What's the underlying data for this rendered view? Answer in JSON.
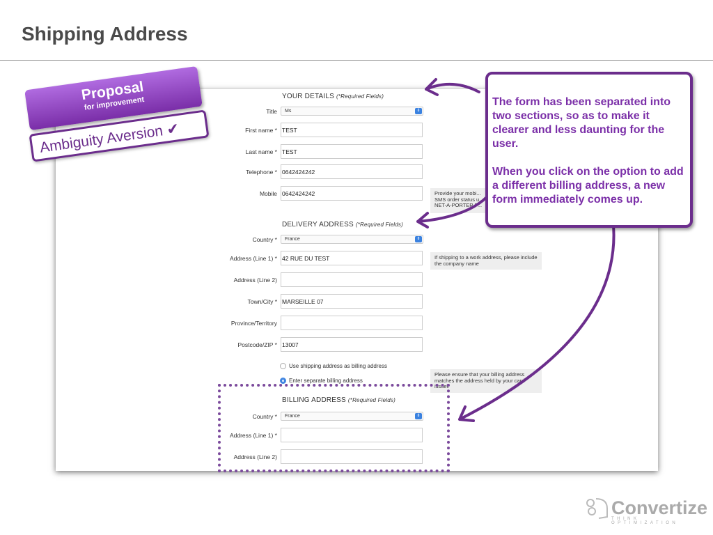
{
  "slide": {
    "title": "Shipping Address"
  },
  "badge": {
    "title": "Proposal",
    "subtitle": "for improvement",
    "tag": "Ambiguity Aversion ✔"
  },
  "callout": {
    "p1": "The form has been separated into two sections, so as to make it clearer and less daunting for the user.",
    "p2": "When you click on the option to add a different billing address, a new form immediately comes up."
  },
  "form": {
    "your_details": {
      "heading": "YOUR DETAILS",
      "note": "(*Required Fields)",
      "title_label": "Title",
      "title_value": "Ms",
      "first_label": "First name *",
      "first_value": "TEST",
      "last_label": "Last name *",
      "last_value": "TEST",
      "tel_label": "Telephone *",
      "tel_value": "0642424242",
      "mobile_label": "Mobile",
      "mobile_value": "0642424242",
      "mobile_tip": "Provide your mobi... SMS order status u... NET-A-PORTER P..."
    },
    "delivery": {
      "heading": "DELIVERY ADDRESS",
      "note": "(*Required Fields)",
      "country_label": "Country *",
      "country_value": "France",
      "addr1_label": "Address (Line 1) *",
      "addr1_value": "42 RUE DU TEST",
      "addr1_tip": "If shipping to a work address, please include the company name",
      "addr2_label": "Address (Line 2)",
      "addr2_value": "",
      "town_label": "Town/City *",
      "town_value": "MARSEILLE 07",
      "province_label": "Province/Territory",
      "province_value": "",
      "zip_label": "Postcode/ZIP *",
      "zip_value": "13007"
    },
    "billing_options": {
      "opt1": "Use shipping address as billing address",
      "opt2": "Enter separate billing address",
      "selected": "opt2",
      "tip": "Please ensure that your billing address matches the address held by your card issuer."
    },
    "billing": {
      "heading": "BILLING ADDRESS",
      "note": "(*Required Fields)",
      "country_label": "Country *",
      "country_value": "France",
      "addr1_label": "Address (Line 1) *",
      "addr2_label": "Address (Line 2)"
    }
  },
  "logo": {
    "name": "Convertize",
    "tagline": "THINK OPTIMIZATION"
  },
  "colors": {
    "accent": "#7b2fa8",
    "select_blue": "#3b82e0"
  }
}
